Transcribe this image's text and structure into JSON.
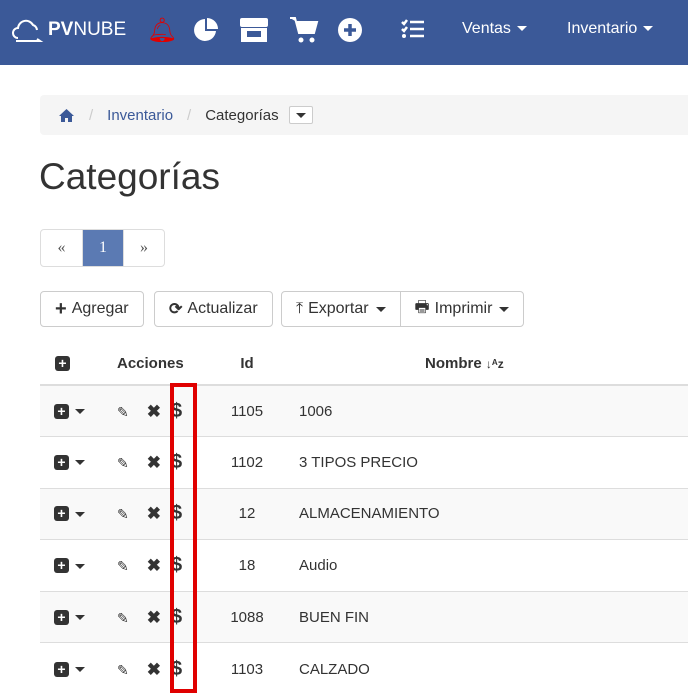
{
  "nav": {
    "brand_bold": "PV",
    "brand_rest": "NUBE",
    "menus": [
      {
        "label": "Ventas"
      },
      {
        "label": "Inventario"
      }
    ],
    "icons": [
      "bell-icon",
      "pie-chart-icon",
      "store-icon",
      "cart-icon",
      "plus-circle-icon",
      "task-list-icon"
    ],
    "bell_color": "#e00000",
    "bg": "#3b5998"
  },
  "breadcrumb": {
    "items": [
      "Inventario",
      "Categorías"
    ]
  },
  "page_title": "Categorías",
  "pagination": {
    "prev": "«",
    "current": "1",
    "next": "»"
  },
  "toolbar": {
    "add": "Agregar",
    "refresh": "Actualizar",
    "export": "Exportar",
    "print": "Imprimir"
  },
  "table": {
    "headers": {
      "actions": "Acciones",
      "id": "Id",
      "name": "Nombre"
    },
    "rows": [
      {
        "id": "1105",
        "name": "1006"
      },
      {
        "id": "1102",
        "name": "3 TIPOS PRECIO"
      },
      {
        "id": "12",
        "name": "ALMACENAMIENTO"
      },
      {
        "id": "18",
        "name": "Audio"
      },
      {
        "id": "1088",
        "name": "BUEN FIN"
      },
      {
        "id": "1103",
        "name": "CALZADO"
      }
    ]
  }
}
